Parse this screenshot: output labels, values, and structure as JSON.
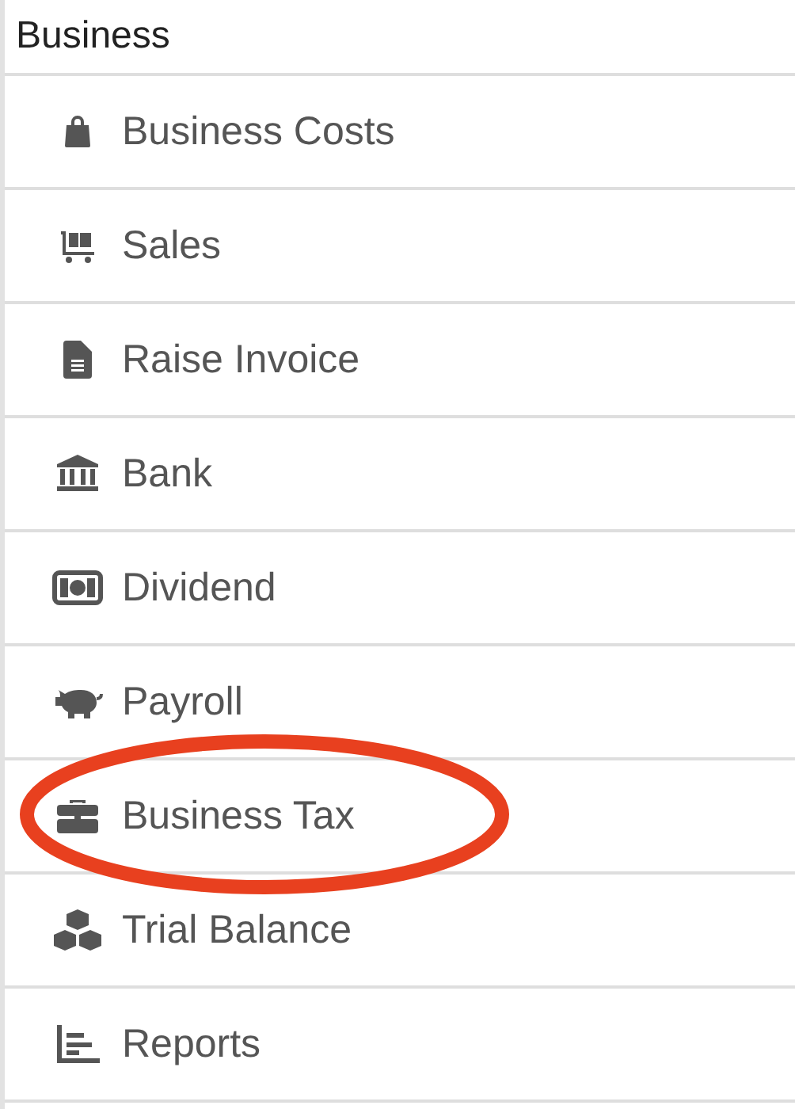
{
  "section": {
    "title": "Business"
  },
  "items": [
    {
      "label": "Business Costs",
      "circled": false
    },
    {
      "label": "Sales",
      "circled": false
    },
    {
      "label": "Raise Invoice",
      "circled": false
    },
    {
      "label": "Bank",
      "circled": false
    },
    {
      "label": "Dividend",
      "circled": false
    },
    {
      "label": "Payroll",
      "circled": false
    },
    {
      "label": "Business Tax",
      "circled": true
    },
    {
      "label": "Trial Balance",
      "circled": false
    },
    {
      "label": "Reports",
      "circled": false
    }
  ]
}
